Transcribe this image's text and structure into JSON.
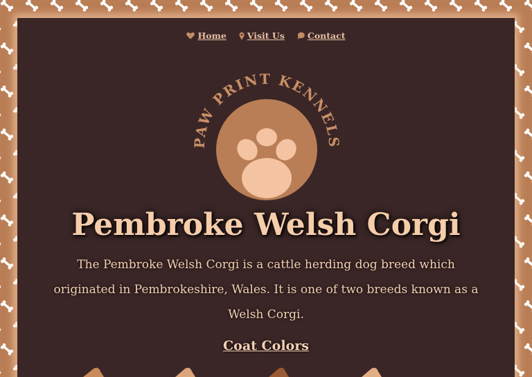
{
  "nav": {
    "items": [
      {
        "label": "Home",
        "icon": "heart-icon"
      },
      {
        "label": "Visit Us",
        "icon": "map-pin-icon"
      },
      {
        "label": "Contact",
        "icon": "speech-bubble-icon"
      }
    ]
  },
  "logo": {
    "text": "PAW PRINT KENNELS",
    "icon": "paw-print-icon"
  },
  "page": {
    "title": "Pembroke Welsh Corgi",
    "intro": "The Pembroke Welsh Corgi is a cattle herding dog breed which originated in Pembrokeshire, Wales. It is one of two breeds known as a Welsh Corgi."
  },
  "sections": {
    "coat_colors_heading": "Coat Colors"
  },
  "colors": {
    "border_tan": "#b97e55",
    "panel_dark": "#3a2626",
    "accent_peach": "#f6cdaa",
    "logo_circle": "#b97e55",
    "paw_pad": "#f4c4a2"
  }
}
